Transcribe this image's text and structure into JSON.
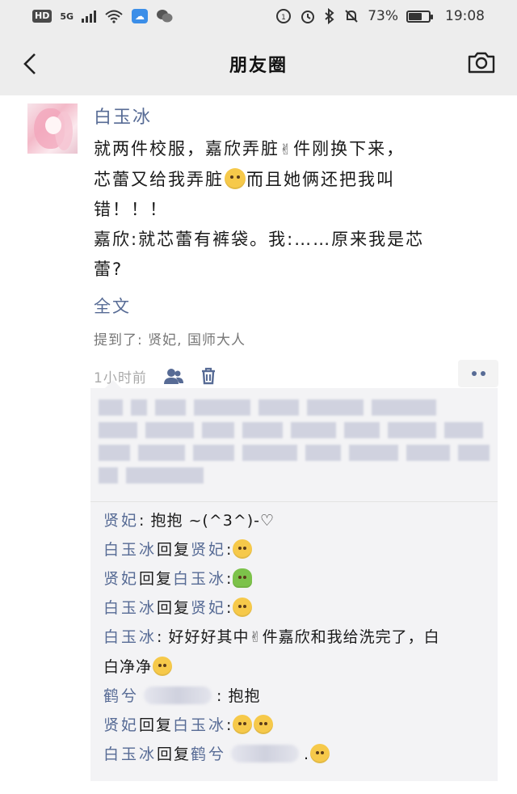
{
  "status_bar": {
    "hd": "HD",
    "network": "5G",
    "battery": "73%",
    "battery_level": 0.73,
    "time": "19:08"
  },
  "nav": {
    "title": "朋友圈",
    "back_icon": "chevron-left-icon",
    "camera_icon": "camera-icon"
  },
  "post": {
    "author": "白玉冰",
    "line1_a": "就两件校服，嘉欣弄脏",
    "line1_b": "件刚换下来，",
    "line2_a": "芯蕾又给我弄脏",
    "line2_b": "而且她俩还把我叫",
    "line3": "错！！！",
    "line4": "嘉欣:就芯蕾有裤袋。我:……原来我是芯",
    "line5": "蕾?",
    "fulltext": "全文",
    "mentioned": "提到了: 贤妃, 国师大人",
    "time": "1小时前"
  },
  "comments": [
    {
      "from": "贤妃",
      "sep": ": ",
      "text": "抱抱 ~(^3^)-♡"
    },
    {
      "from": "白玉冰",
      "mid": "回复",
      "to": "贤妃",
      "sep": ":"
    },
    {
      "from": "贤妃",
      "mid": "回复",
      "to": "白玉冰",
      "sep": ":"
    },
    {
      "from": "白玉冰",
      "mid": "回复",
      "to": "贤妃",
      "sep": ":"
    },
    {
      "from": "白玉冰",
      "sep": ": ",
      "text_a": "好好好其中",
      "text_b": "件嘉欣和我给洗完了，白",
      "text_c": "白净净"
    },
    {
      "from": "鹤兮",
      "text": ": 抱抱"
    },
    {
      "from": "贤妃",
      "mid": "回复",
      "to": "白玉冰",
      "sep": ":"
    },
    {
      "from": "白玉冰",
      "mid": "回复",
      "to": "鹤兮",
      "sep": "."
    }
  ]
}
